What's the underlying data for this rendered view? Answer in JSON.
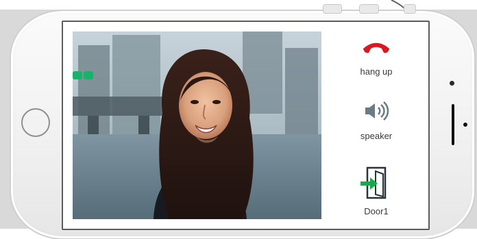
{
  "call_screen": {
    "controls": {
      "hang_up_label": "hang up",
      "speaker_label": "speaker",
      "door_label": "Door1"
    },
    "icons": {
      "hang_up": "phone-handset-icon",
      "speaker": "speaker-icon",
      "door": "door-exit-icon",
      "video_status": "camera-status-icon"
    },
    "colors": {
      "hang_up": "#d71920",
      "door_arrow": "#19a84a",
      "video_status": "#16b46b",
      "phone_frame": "#f3f3f3",
      "screen_border": "#5c5c5c"
    }
  }
}
